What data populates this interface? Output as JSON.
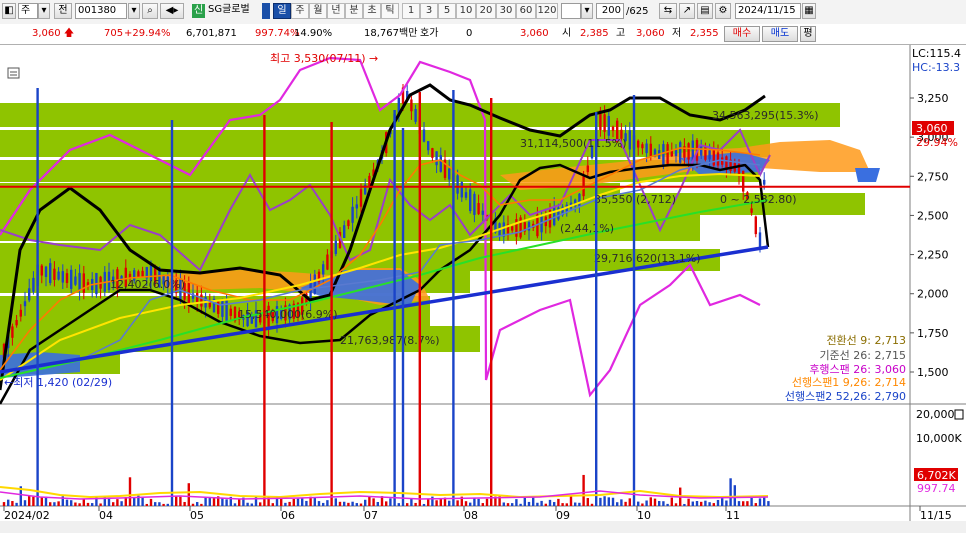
{
  "toolbar": {
    "period_main": "주",
    "prev_label": "전",
    "code": "001380",
    "market_badge": "신",
    "stock_name": "SG글로벌",
    "timeframes": [
      "일",
      "주",
      "월",
      "년",
      "분",
      "초",
      "틱"
    ],
    "active_timeframe": "일",
    "intervals": [
      "1",
      "3",
      "5",
      "10",
      "20",
      "30",
      "60",
      "120"
    ],
    "count": "200",
    "total": "/625",
    "date": "2024/11/15"
  },
  "quote": {
    "price": "3,060",
    "change": "705",
    "change_pct": "+29.94%",
    "volume": "6,701,871",
    "volume_ratio": "997.74%",
    "turnover": "14.90%",
    "amount": "18,767백만",
    "hoga_label": "호가",
    "hoga_value": "0",
    "current": "3,060",
    "open_label": "시",
    "open": "2,385",
    "high_label": "고",
    "high": "3,060",
    "low_label": "저",
    "low": "2,355",
    "buy_label": "매수",
    "sell_label": "매도",
    "eval_label": "평"
  },
  "colors": {
    "up": "#e00000",
    "down": "#0030d0",
    "cloud_green": "#8fc400",
    "ichimoku_blue": "#0030d0"
  },
  "chart_data": {
    "type": "candlestick",
    "panel": "price",
    "y_ticks": [
      "3,250",
      "3,000",
      "2,750",
      "2,500",
      "2,250",
      "2,000",
      "1,750",
      "1,500"
    ],
    "x_ticks": [
      "2024/02",
      "04",
      "05",
      "06",
      "07",
      "08",
      "09",
      "10",
      "11",
      "11/15"
    ],
    "lc_label": "LC:115.4",
    "hc_label": "HC:-13.3",
    "last_price_tag": "3,060",
    "last_pct_tag": "29.94%",
    "horizontal_line": 2683,
    "annotations": {
      "high": "최고 3,530(07/11) →",
      "low": "←최저 1,420 (02/29)"
    },
    "volume_profile_labels": [
      "34,563,295(15.3%)",
      "31,114,500(11.5%)",
      "35,550,(2,712)",
      "0 ~ 2,532.80)",
      "(2,44,1%)",
      "29,716,620(13.1%)",
      "12,402(6.0%)",
      "15,540,000(6.9%)",
      "21,763,987(8.7%)"
    ],
    "legend": [
      {
        "name": "전환선 9",
        "value": "2,713",
        "color": "#8a6d00"
      },
      {
        "name": "기준선 26",
        "value": "2,715",
        "color": "#555555"
      },
      {
        "name": "후행스팬 26",
        "value": "3,060",
        "color": "#c800c8"
      },
      {
        "name": "선행스팬1 9,26",
        "value": "2,714",
        "color": "#ff8800"
      },
      {
        "name": "선행스팬2 52,26",
        "value": "2,790",
        "color": "#1a44c8"
      }
    ],
    "volume_ticks": [
      "20,000K",
      "10,000K"
    ],
    "volume_last": "6,702K",
    "volume_last_pct": "997.74"
  }
}
